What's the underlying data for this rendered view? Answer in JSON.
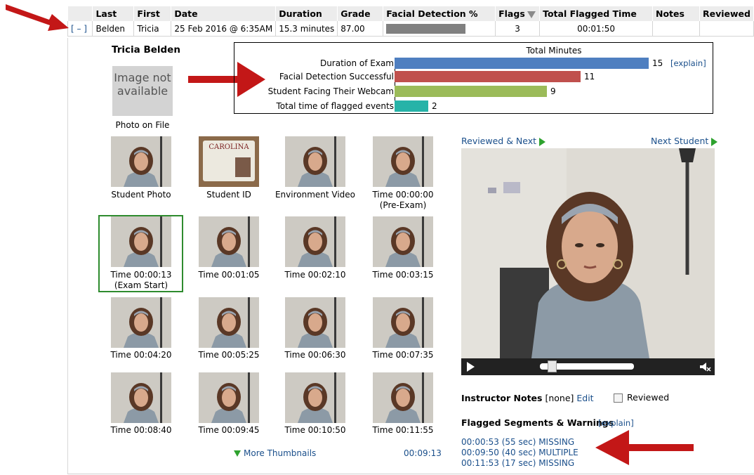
{
  "table": {
    "headers": {
      "last": "Last",
      "first": "First",
      "date": "Date",
      "duration": "Duration",
      "grade": "Grade",
      "facial": "Facial Detection %",
      "flags": "Flags",
      "flagged_time": "Total Flagged Time",
      "notes": "Notes",
      "reviewed": "Reviewed"
    },
    "row": {
      "toggle": "[ – ]",
      "last": "Belden",
      "first": "Tricia",
      "date": "25 Feb 2016 @ 6:35AM",
      "duration": "15.3 minutes",
      "grade": "87.00",
      "flags": "3",
      "flagged_time": "00:01:50",
      "notes": "",
      "reviewed": ""
    }
  },
  "student_name": "Tricia Belden",
  "no_image_text": "Image not available",
  "photo_on_file": "Photo on File",
  "chart_data": {
    "type": "bar",
    "title": "Total Minutes",
    "categories": [
      "Duration of Exam",
      "Facial Detection Successful",
      "Student Facing Their Webcam",
      "Total time of flagged events"
    ],
    "values": [
      15,
      11,
      9,
      2
    ],
    "colors": [
      "#4f7fc0",
      "#c0504d",
      "#9bbb59",
      "#26b3a8"
    ],
    "xlim": [
      0,
      15
    ]
  },
  "chart_explain": "[explain]",
  "thumbnails": [
    {
      "caption": "Student Photo"
    },
    {
      "caption": "Student ID"
    },
    {
      "caption": "Environment Video"
    },
    {
      "caption": "Time 00:00:00\n(Pre-Exam)"
    },
    {
      "caption": "Time 00:00:13\n(Exam Start)"
    },
    {
      "caption": "Time 00:01:05"
    },
    {
      "caption": "Time 00:02:10"
    },
    {
      "caption": "Time 00:03:15"
    },
    {
      "caption": "Time 00:04:20"
    },
    {
      "caption": "Time 00:05:25"
    },
    {
      "caption": "Time 00:06:30"
    },
    {
      "caption": "Time 00:07:35"
    },
    {
      "caption": "Time 00:08:40"
    },
    {
      "caption": "Time 00:09:45"
    },
    {
      "caption": "Time 00:10:50"
    },
    {
      "caption": "Time 00:11:55"
    }
  ],
  "id_card_text": "CAROLINA",
  "more_thumbnails": "More Thumbnails",
  "current_time": "00:09:13",
  "reviewed_next": "Reviewed & Next",
  "next_student": "Next Student",
  "instructor_notes_label": "Instructor Notes",
  "instructor_notes_value": "[none]",
  "edit_link": "Edit",
  "reviewed_label": "Reviewed",
  "flagged_title": "Flagged Segments & Warnings",
  "flagged_explain": "[explain]",
  "flagged_items": [
    "00:00:53 (55 sec) MISSING",
    "00:09:50 (40 sec) MULTIPLE",
    "00:11:53 (17 sec) MISSING"
  ],
  "video_progress": 0.08,
  "colors": {
    "link": "#1a4f8b",
    "arrow": "#cc1111",
    "select_border": "#2e8b2e"
  }
}
